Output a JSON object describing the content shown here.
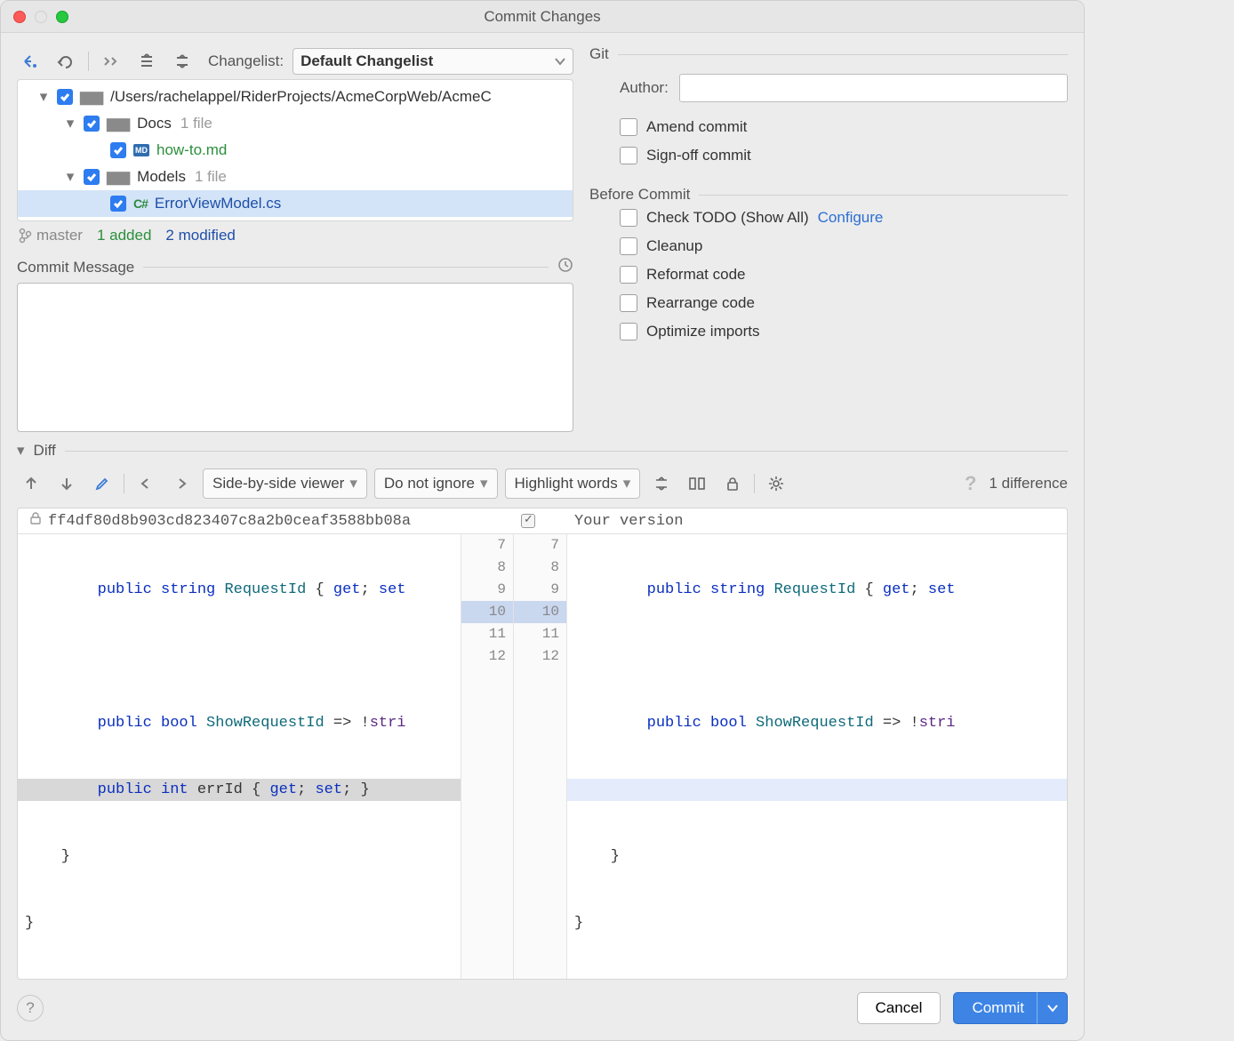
{
  "window": {
    "title": "Commit Changes"
  },
  "toolbar": {
    "changelist_label": "Changelist:",
    "changelist_value": "Default Changelist"
  },
  "tree": {
    "root": {
      "path": "/Users/rachelappel/RiderProjects/AcmeCorpWeb/AcmeC"
    },
    "docs": {
      "name": "Docs",
      "count_label": "1 file",
      "file": "how-to.md"
    },
    "models": {
      "name": "Models",
      "count_label": "1 file",
      "file": "ErrorViewModel.cs"
    }
  },
  "branch": {
    "name": "master",
    "added": "1 added",
    "modified": "2 modified"
  },
  "commit_message": {
    "header": "Commit Message"
  },
  "git_panel": {
    "header": "Git",
    "author_label": "Author:",
    "amend": "Amend commit",
    "signoff": "Sign-off commit"
  },
  "before_commit": {
    "header": "Before Commit",
    "todo": "Check TODO (Show All)",
    "configure": "Configure",
    "cleanup": "Cleanup",
    "reformat": "Reformat code",
    "rearrange": "Rearrange code",
    "optimize": "Optimize imports"
  },
  "diff": {
    "header": "Diff",
    "viewer_mode": "Side-by-side viewer",
    "ignore_mode": "Do not ignore",
    "highlight_mode": "Highlight words",
    "count": "1 difference",
    "left_title": "ff4df80d8b903cd823407c8a2b0ceaf3588bb08a",
    "right_title": "Your version",
    "left_lines": [
      "7",
      "8",
      "9",
      "10",
      "11",
      "12"
    ],
    "right_lines": [
      "7",
      "8",
      "9",
      "10",
      "11",
      "12"
    ],
    "code_left": {
      "l1": "        public string RequestId { get; set",
      "l2": "",
      "l3": "        public bool ShowRequestId => !stri",
      "l4": "        public int errId { get; set; }",
      "l5": "    }",
      "l6": "}"
    },
    "code_right": {
      "l1": "        public string RequestId { get; set",
      "l2": "",
      "l3": "        public bool ShowRequestId => !stri",
      "l4": "",
      "l5": "    }",
      "l6": "}"
    }
  },
  "footer": {
    "cancel": "Cancel",
    "commit": "Commit"
  }
}
